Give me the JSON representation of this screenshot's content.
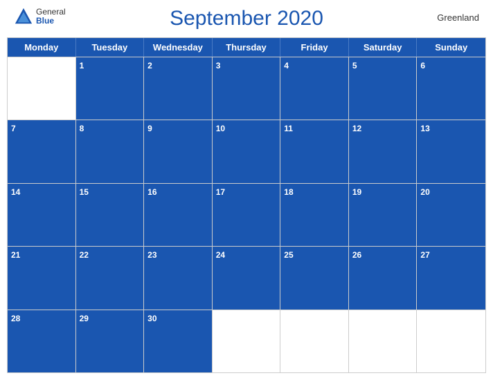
{
  "header": {
    "title": "September 2020",
    "region": "Greenland",
    "logo": {
      "general": "General",
      "blue": "Blue"
    }
  },
  "calendar": {
    "weekdays": [
      "Monday",
      "Tuesday",
      "Wednesday",
      "Thursday",
      "Friday",
      "Saturday",
      "Sunday"
    ],
    "weeks": [
      {
        "days": [
          {
            "number": "",
            "empty": true
          },
          {
            "number": "1",
            "header": true
          },
          {
            "number": "2",
            "header": true
          },
          {
            "number": "3",
            "header": true
          },
          {
            "number": "4",
            "header": true
          },
          {
            "number": "5",
            "header": true
          },
          {
            "number": "6",
            "header": true
          }
        ]
      },
      {
        "days": [
          {
            "number": "7",
            "header": true
          },
          {
            "number": "8",
            "header": true
          },
          {
            "number": "9",
            "header": true
          },
          {
            "number": "10",
            "header": true
          },
          {
            "number": "11",
            "header": true
          },
          {
            "number": "12",
            "header": true
          },
          {
            "number": "13",
            "header": true
          }
        ]
      },
      {
        "days": [
          {
            "number": "14",
            "header": true
          },
          {
            "number": "15",
            "header": true
          },
          {
            "number": "16",
            "header": true
          },
          {
            "number": "17",
            "header": true
          },
          {
            "number": "18",
            "header": true
          },
          {
            "number": "19",
            "header": true
          },
          {
            "number": "20",
            "header": true
          }
        ]
      },
      {
        "days": [
          {
            "number": "21",
            "header": true
          },
          {
            "number": "22",
            "header": true
          },
          {
            "number": "23",
            "header": true
          },
          {
            "number": "24",
            "header": true
          },
          {
            "number": "25",
            "header": true
          },
          {
            "number": "26",
            "header": true
          },
          {
            "number": "27",
            "header": true
          }
        ]
      },
      {
        "days": [
          {
            "number": "28",
            "header": true
          },
          {
            "number": "29",
            "header": true
          },
          {
            "number": "30",
            "header": true
          },
          {
            "number": "",
            "empty": true
          },
          {
            "number": "",
            "empty": true
          },
          {
            "number": "",
            "empty": true
          },
          {
            "number": "",
            "empty": true
          }
        ]
      }
    ]
  },
  "colors": {
    "primary": "#1a56b0",
    "border": "#ccc",
    "text": "#333"
  }
}
